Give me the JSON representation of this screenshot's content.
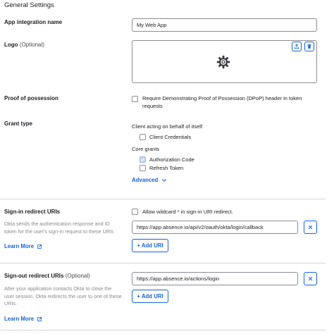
{
  "section_title": "General Settings",
  "app_name": {
    "label": "App integration name",
    "value": "My Web App"
  },
  "logo": {
    "label": "Logo",
    "optional": "(Optional)",
    "upload_icon": "upload-icon",
    "delete_icon": "trash-icon",
    "placeholder_icon": "gear-icon"
  },
  "proof_of_possession": {
    "label": "Proof of possession",
    "checkbox_text": "Require Demonstrating Proof of Possession (DPoP) header in token requests",
    "checked": false
  },
  "grant_type": {
    "label": "Grant type",
    "self_heading": "Client acting on behalf of itself",
    "client_credentials": "Client Credentials",
    "core_heading": "Core grants",
    "authorization_code": "Authorization Code",
    "refresh_token": "Refresh Token",
    "advanced": "Advanced"
  },
  "sign_in": {
    "label": "Sign-in redirect URIs",
    "wildcard_text": "Allow wildcard * in sign-in URI redirect.",
    "help": "Okta sends the authentication response and ID token for the user's sign-in request to these URIs",
    "uri_value": "https://app.absence.io/api/v2/oauth/okta/login/callback",
    "add_label": "Add URI",
    "learn_more": "Learn More"
  },
  "sign_out": {
    "label": "Sign-out redirect URIs",
    "optional": "(Optional)",
    "help": "After your application contacts Okta to close the user session, Okta redirects the user to one of these URIs.",
    "uri_value": "https://app.absence.io/actions/login",
    "add_label": "Add URI",
    "learn_more": "Learn More"
  },
  "colors": {
    "accent": "#1662dd",
    "border": "#8c8c96",
    "muted": "#8a8a8f"
  }
}
